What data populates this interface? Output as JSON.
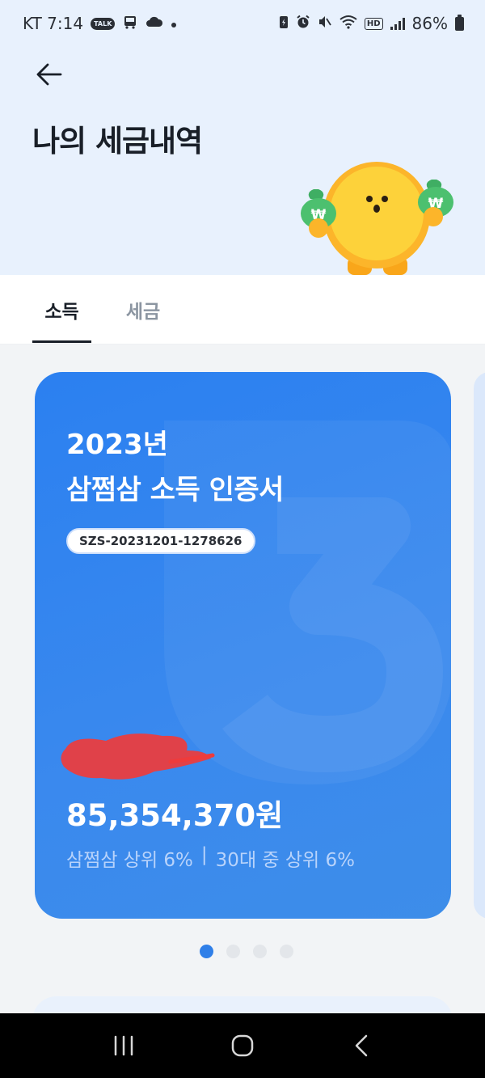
{
  "status_bar": {
    "carrier_time": "KT 7:14",
    "talk_badge": "TALK",
    "hd_label": "HD",
    "battery_percent": "86%"
  },
  "header": {
    "title": "나의 세금내역"
  },
  "tabs": [
    {
      "label": "소득",
      "active": true
    },
    {
      "label": "세금",
      "active": false
    }
  ],
  "card": {
    "year": "2023년",
    "title": "삼쩜삼 소득 인증서",
    "cert_number": "SZS-20231201-1278626",
    "amount": "85,354,370원",
    "rank_overall": "삼쩜삼 상위 6%",
    "divider": "|",
    "rank_age": "30대 중 상위 6%",
    "watermark_icon": "three-logo-icon",
    "accent_color": "#2f7fe8"
  },
  "pager": {
    "count": 4,
    "active_index": 0
  },
  "mascot": {
    "icon": "mascot-with-money-bags-icon",
    "money_symbol": "₩"
  },
  "nav_bar": {
    "icons": [
      "recent-apps-icon",
      "home-icon",
      "back-nav-icon"
    ]
  }
}
